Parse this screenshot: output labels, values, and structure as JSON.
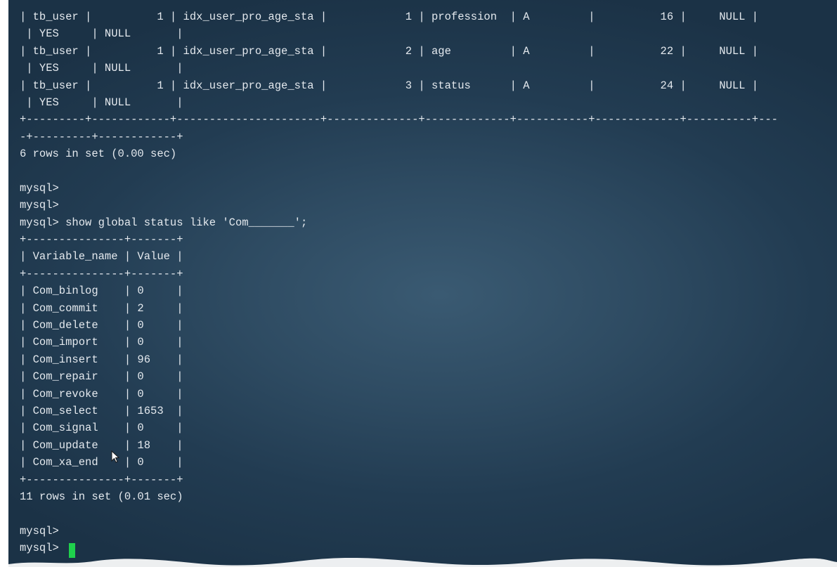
{
  "terminal": {
    "lines": [
      "| tb_user |          1 | idx_user_pro_age_sta |            1 | profession  | A         |          16 |     NULL |   ",
      " | YES     | NULL       |",
      "| tb_user |          1 | idx_user_pro_age_sta |            2 | age         | A         |          22 |     NULL |   ",
      " | YES     | NULL       |",
      "| tb_user |          1 | idx_user_pro_age_sta |            3 | status      | A         |          24 |     NULL |   ",
      " | YES     | NULL       |",
      "+---------+------------+----------------------+--------------+-------------+-----------+-------------+----------+---",
      "-+---------+------------+",
      "6 rows in set (0.00 sec)",
      "",
      "mysql>",
      "mysql>",
      "mysql> show global status like 'Com_______';",
      "+---------------+-------+",
      "| Variable_name | Value |",
      "+---------------+-------+",
      "| Com_binlog    | 0     |",
      "| Com_commit    | 2     |",
      "| Com_delete    | 0     |",
      "| Com_import    | 0     |",
      "| Com_insert    | 96    |",
      "| Com_repair    | 0     |",
      "| Com_revoke    | 0     |",
      "| Com_select    | 1653  |",
      "| Com_signal    | 0     |",
      "| Com_update    | 18    |",
      "| Com_xa_end    | 0     |",
      "+---------------+-------+",
      "11 rows in set (0.01 sec)",
      "",
      "mysql>",
      "mysql> "
    ]
  },
  "colors": {
    "text": "#e4e9ee",
    "cursor": "#1fd04c",
    "background": "#2e4b62"
  }
}
